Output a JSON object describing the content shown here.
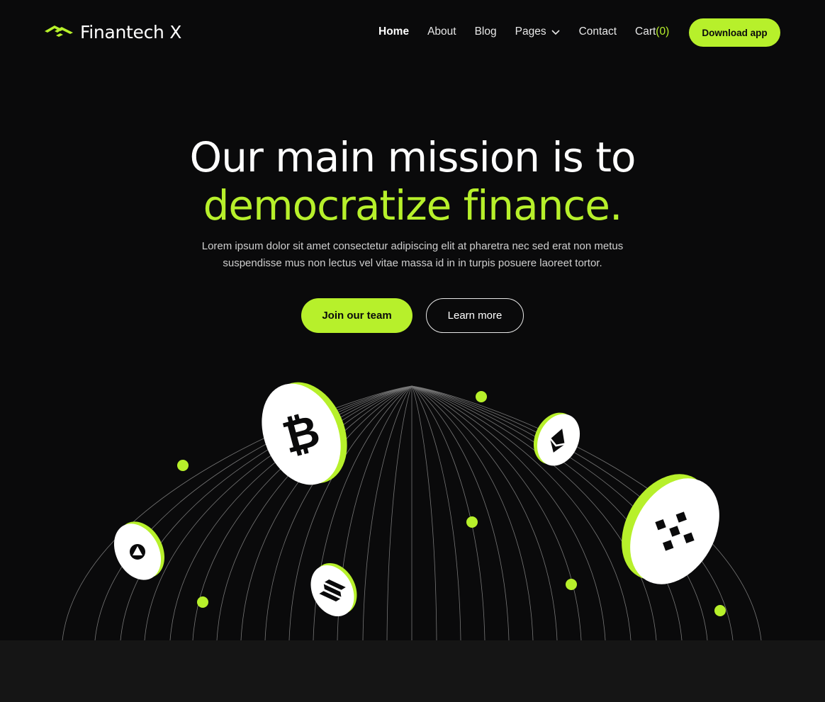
{
  "brand": {
    "name": "Finantech X",
    "logo_icon": "chevron-wing-logo-icon",
    "accent_color": "#b7f02b"
  },
  "nav": {
    "items": [
      {
        "label": "Home",
        "active": true
      },
      {
        "label": "About"
      },
      {
        "label": "Blog"
      },
      {
        "label": "Pages",
        "icon": "chevron-down-icon"
      },
      {
        "label": "Contact"
      }
    ],
    "cart_label": "Cart",
    "cart_count": "(0)",
    "download_label": "Download app"
  },
  "hero": {
    "headline_line1": "Our  main mission is to",
    "headline_line2": "democratize finance.",
    "subtext_line1": "Lorem ipsum dolor sit amet consectetur adipiscing elit at pharetra nec sed erat non metus",
    "subtext_line2": "suspendisse mus non lectus vel vitae massa id in in turpis posuere laoreet tortor.",
    "primary_cta": "Join our team",
    "secondary_cta": "Learn more"
  },
  "coins": [
    {
      "name": "bitcoin-coin",
      "icon": "bitcoin-icon"
    },
    {
      "name": "ethereum-coin",
      "icon": "ethereum-icon"
    },
    {
      "name": "binance-coin",
      "icon": "binance-icon"
    },
    {
      "name": "avalanche-coin",
      "icon": "avalanche-icon"
    },
    {
      "name": "solana-coin",
      "icon": "solana-icon"
    }
  ],
  "colors": {
    "background": "#0a0a0b",
    "accent": "#b7f02b",
    "footer_band": "#151515"
  }
}
